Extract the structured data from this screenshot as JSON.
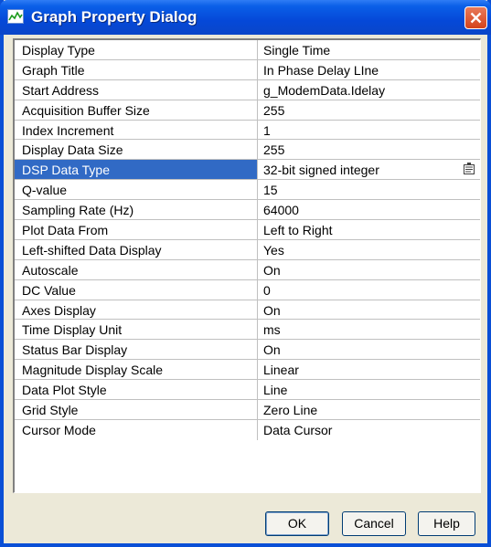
{
  "dialog": {
    "title": "Graph Property Dialog",
    "title_icon": "graph-icon",
    "close_icon": "close-icon",
    "accent_color": "#0a5fe8",
    "selection_color": "#316ac5"
  },
  "properties": [
    {
      "name": "Display Type",
      "value": "Single Time"
    },
    {
      "name": "Graph Title",
      "value": "In Phase Delay LIne"
    },
    {
      "name": "Start Address",
      "value": "g_ModemData.Idelay"
    },
    {
      "name": "Acquisition Buffer Size",
      "value": "255"
    },
    {
      "name": "Index Increment",
      "value": "1"
    },
    {
      "name": "Display Data Size",
      "value": "255"
    },
    {
      "name": "DSP Data Type",
      "value": "32-bit signed integer",
      "selected": true,
      "dropdown": true
    },
    {
      "name": "Q-value",
      "value": "15"
    },
    {
      "name": "Sampling Rate (Hz)",
      "value": "64000"
    },
    {
      "name": "Plot Data From",
      "value": "Left to Right"
    },
    {
      "name": "Left-shifted Data Display",
      "value": "Yes"
    },
    {
      "name": "Autoscale",
      "value": "On"
    },
    {
      "name": "DC Value",
      "value": "0"
    },
    {
      "name": "Axes Display",
      "value": "On"
    },
    {
      "name": "Time Display Unit",
      "value": "ms"
    },
    {
      "name": "Status Bar Display",
      "value": "On"
    },
    {
      "name": "Magnitude Display Scale",
      "value": "Linear"
    },
    {
      "name": "Data Plot Style",
      "value": "Line"
    },
    {
      "name": "Grid Style",
      "value": "Zero Line"
    },
    {
      "name": "Cursor Mode",
      "value": "Data Cursor"
    }
  ],
  "buttons": {
    "ok": "OK",
    "cancel": "Cancel",
    "help": "Help"
  }
}
